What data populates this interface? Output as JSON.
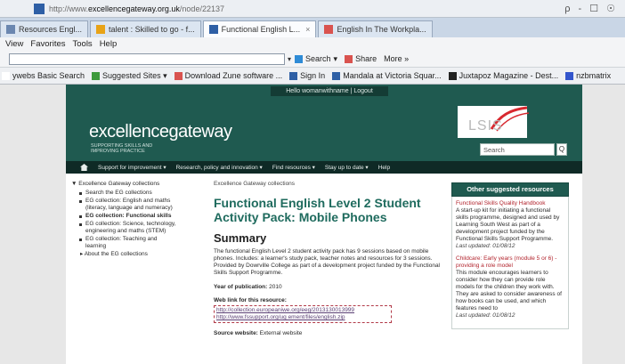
{
  "browser": {
    "url_prefix": "http://www.",
    "url_domain": "excellencegateway.org.uk",
    "url_path": "/node/22137",
    "window_controls": "ρ - ☐ ☉",
    "tabs": [
      {
        "label": "Resources Engl...",
        "color": "#6b87b0",
        "active": false
      },
      {
        "label": "talent : Skilled to go - f...",
        "color": "#e8a317",
        "active": false
      },
      {
        "label": "Functional English L...",
        "color": "#2e5fa5",
        "active": true
      },
      {
        "label": "English In The Workpla...",
        "color": "#d9534f",
        "active": false
      }
    ],
    "tab_close": "×",
    "menu": [
      "View",
      "Favorites",
      "Tools",
      "Help"
    ],
    "command_bar": {
      "dropdown": "▾",
      "search_label": "Search",
      "search_drop": "▾",
      "share_label": "Share",
      "more_label": "More »"
    },
    "favorites": [
      {
        "label": "ywebs Basic Search",
        "color": "#ffffff"
      },
      {
        "label": "Suggested Sites ▾",
        "color": "#3d9a3d"
      },
      {
        "label": "Download Zune software ...",
        "color": "#d9534f"
      },
      {
        "label": "Sign In",
        "color": "#2e5fa5"
      },
      {
        "label": "Mandala at Victoria Squar...",
        "color": "#2e5fa5"
      },
      {
        "label": "Juxtapoz Magazine - Dest...",
        "color": "#222222"
      },
      {
        "label": "nzbmatrix",
        "color": "#3355cc"
      }
    ]
  },
  "site": {
    "user_strip": "Hello womanwithname | Logout",
    "logo": "excellencegateway",
    "tagline": "Supporting skills and improving practice",
    "lsis": "LSIS",
    "search_placeholder": "Search",
    "search_button": "Q",
    "nav": [
      "Support for improvement ▾",
      "Research, policy and innovation ▾",
      "Find resources ▾",
      "Stay up to date ▾",
      "Help"
    ],
    "left": {
      "title": "▼ Excellence Gateway collections",
      "items": [
        {
          "label": "Search the EG collections",
          "bold": false
        },
        {
          "label": "EG collection: English and maths (literacy, language and numeracy)",
          "bold": false
        },
        {
          "label": "EG collection: Functional skills",
          "bold": true
        },
        {
          "label": "EG collection: Science, technology, engineering and maths (STEM)",
          "bold": false
        },
        {
          "label": "EG collection: Teaching and learning",
          "bold": false
        }
      ],
      "footer": "▸ About the EG collections"
    },
    "main": {
      "breadcrumb": "Excellence Gateway collections",
      "title": "Functional English Level 2 Student Activity Pack: Mobile Phones",
      "summary_heading": "Summary",
      "summary": "The functional English Level 2 student activity pack has 9 sessions based on mobile phones. Includes: a learner's study pack, teacher notes and resources for 3 sessions. Provided by Dowrville College as part of a development project funded by the Functional Skills Support Programme.",
      "year_label": "Year of publication:",
      "year_value": "2010",
      "web_link_label": "Web link for this resource:",
      "web_link": "http://collection.europeaniwe.org/eeg/2013130013999 http://www.fssupport.org/ug ement/files/english.zip",
      "source_label": "Source website:",
      "source_value": "External website"
    },
    "right": {
      "heading": "Other suggested resources",
      "items": [
        {
          "link": "Functional Skills Quality Handbook",
          "text": "A start-up kit for initiating a functional skills programme, designed and used by Learning South West as part of a development project funded by the Functional Skills Support Programme.",
          "date": "Last updated: 01/08/12"
        },
        {
          "link": "Childcare: Early years (module 5 or 6) - providing a role model",
          "text": "This module encourages learners to consider how they can provide role models for the children they work with. They are asked to consider awareness of how books can be used, and which features need to",
          "date": "Last updated: 01/08/12"
        }
      ]
    }
  }
}
